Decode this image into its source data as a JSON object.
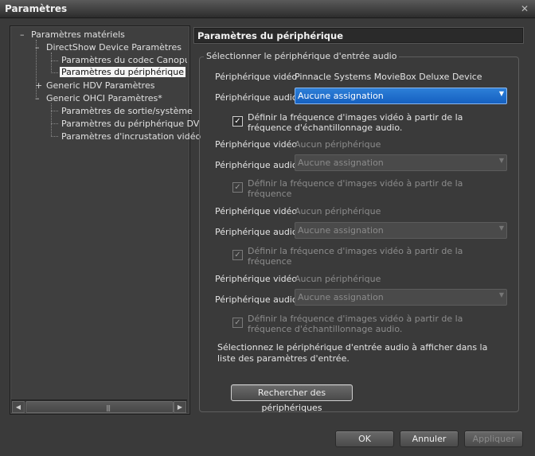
{
  "window": {
    "title": "Paramètres",
    "close_glyph": "✕"
  },
  "tree": {
    "root": {
      "label": "Paramètres matériels",
      "toggle": "–"
    },
    "directshow": {
      "label": "DirectShow Device Paramètres",
      "toggle": "–"
    },
    "codec": {
      "label": "Paramètres du codec Canopus HQ"
    },
    "peripherique": {
      "label": "Paramètres du périphérique"
    },
    "hdv": {
      "label": "Generic HDV Paramètres",
      "toggle": "+"
    },
    "ohci": {
      "label": "Generic OHCI Paramètres*",
      "toggle": "–"
    },
    "sortie": {
      "label": "Paramètres de sortie/système"
    },
    "dv": {
      "label": "Paramètres du périphérique DV"
    },
    "incrustation": {
      "label": "Paramètres d'incrustation vidéo"
    },
    "scroll": {
      "left": "◀",
      "right": "▶",
      "grip": "|||"
    }
  },
  "section_title": "Paramètres du périphérique",
  "group_label": "Sélectionner le périphérique d'entrée audio",
  "labels": {
    "video": "Périphérique vidéo",
    "audio": "Périphérique audio"
  },
  "devices": [
    {
      "video_value": "Pinnacle Systems MovieBox Deluxe Device",
      "audio_value": "Aucune assignation",
      "checkbox": "Définir la fréquence d'images vidéo à partir de la fréquence d'échantillonnage audio.",
      "checked": true,
      "enabled": true
    },
    {
      "video_value": "Aucun périphérique",
      "audio_value": "Aucune assignation",
      "checkbox": "Définir la fréquence d'images vidéo à partir de la fréquence",
      "checked": true,
      "enabled": false
    },
    {
      "video_value": "Aucun périphérique",
      "audio_value": "Aucune assignation",
      "checkbox": "Définir la fréquence d'images vidéo à partir de la fréquence",
      "checked": true,
      "enabled": false
    },
    {
      "video_value": "Aucun périphérique",
      "audio_value": "Aucune assignation",
      "checkbox": "Définir la fréquence d'images vidéo à partir de la fréquence d'échantillonnage audio.",
      "checked": true,
      "enabled": false
    }
  ],
  "info_text": "Sélectionnez le périphérique d'entrée audio à afficher dans la liste des paramètres d'entrée.",
  "buttons": {
    "search": "Rechercher des périphériques",
    "ok": "OK",
    "cancel": "Annuler",
    "apply": "Appliquer"
  },
  "glyphs": {
    "check": "✓",
    "dropdown": "▼"
  },
  "colors": {
    "accent": "#1e6fd0",
    "background": "#3a3a3a"
  }
}
